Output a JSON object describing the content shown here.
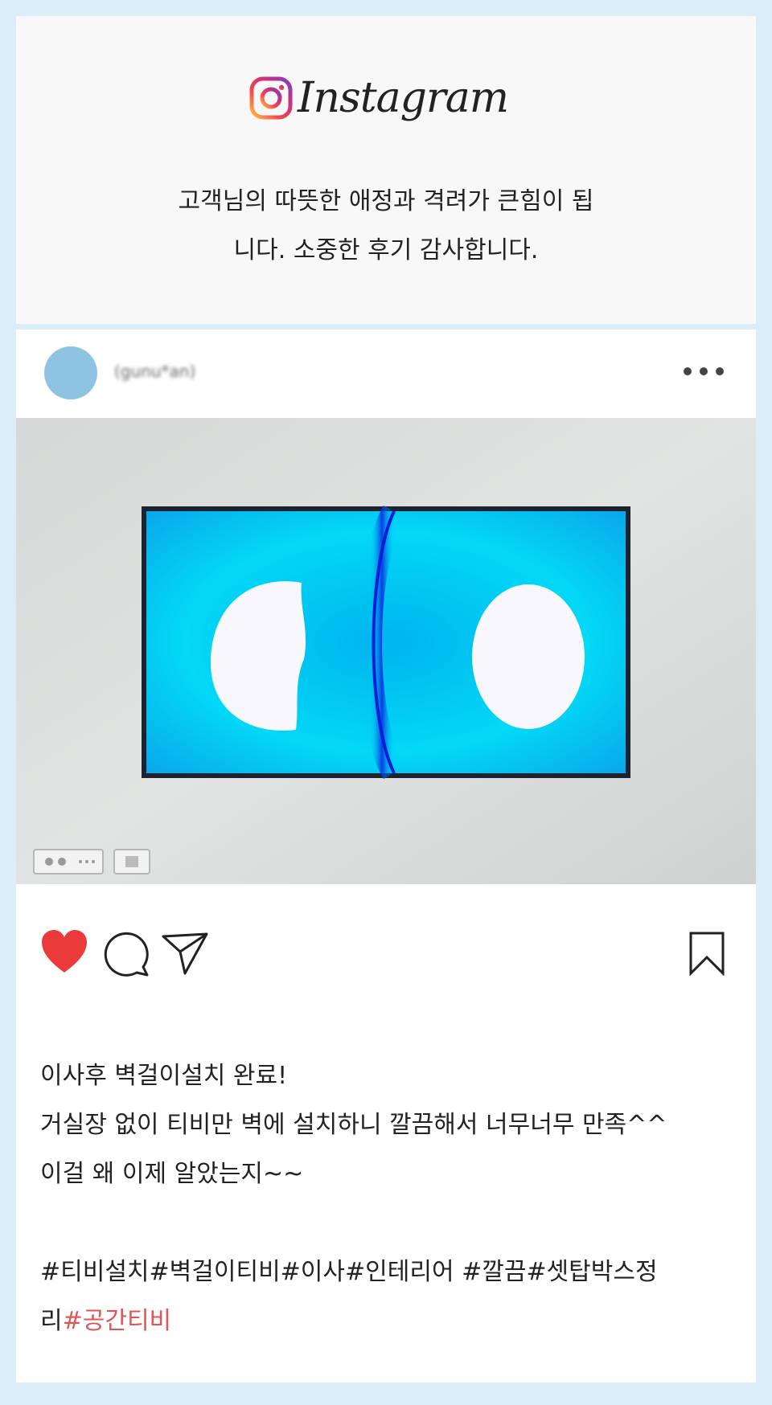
{
  "header": {
    "brand_name": "Instagram",
    "thanks_line1": "고객님의 따뜻한 애정과 격려가 큰힘이 됩",
    "thanks_line2": "니다. 소중한 후기 감사합니다."
  },
  "post": {
    "username": "(gunu*an)",
    "photo_icon": "tv-photo",
    "actions": {
      "like_icon": "heart-icon",
      "comment_icon": "comment-icon",
      "share_icon": "share-icon",
      "save_icon": "bookmark-icon",
      "liked": true
    },
    "caption": {
      "line1": "이사후 벽걸이설치 완료!",
      "line2": "거실장 없이 티비만 벽에 설치하니 깔끔해서 너무너무 만족^^",
      "line3": "이걸 왜 이제 알았는지~~",
      "hashtags_line1": "#티비설치#벽걸이티비#이사#인테리어 #깔끔#셋탑박스정",
      "hashtags_line2_plain": "리",
      "hashtags_line2_highlight": "#공간티비"
    }
  },
  "colors": {
    "page_background": "#dbedf8",
    "header_background": "#f8f8f8",
    "avatar": "#8fc3e3",
    "like_red": "#ea3a3a",
    "highlight_hashtag": "#e05555",
    "tv_screen": "#00c8f2"
  }
}
